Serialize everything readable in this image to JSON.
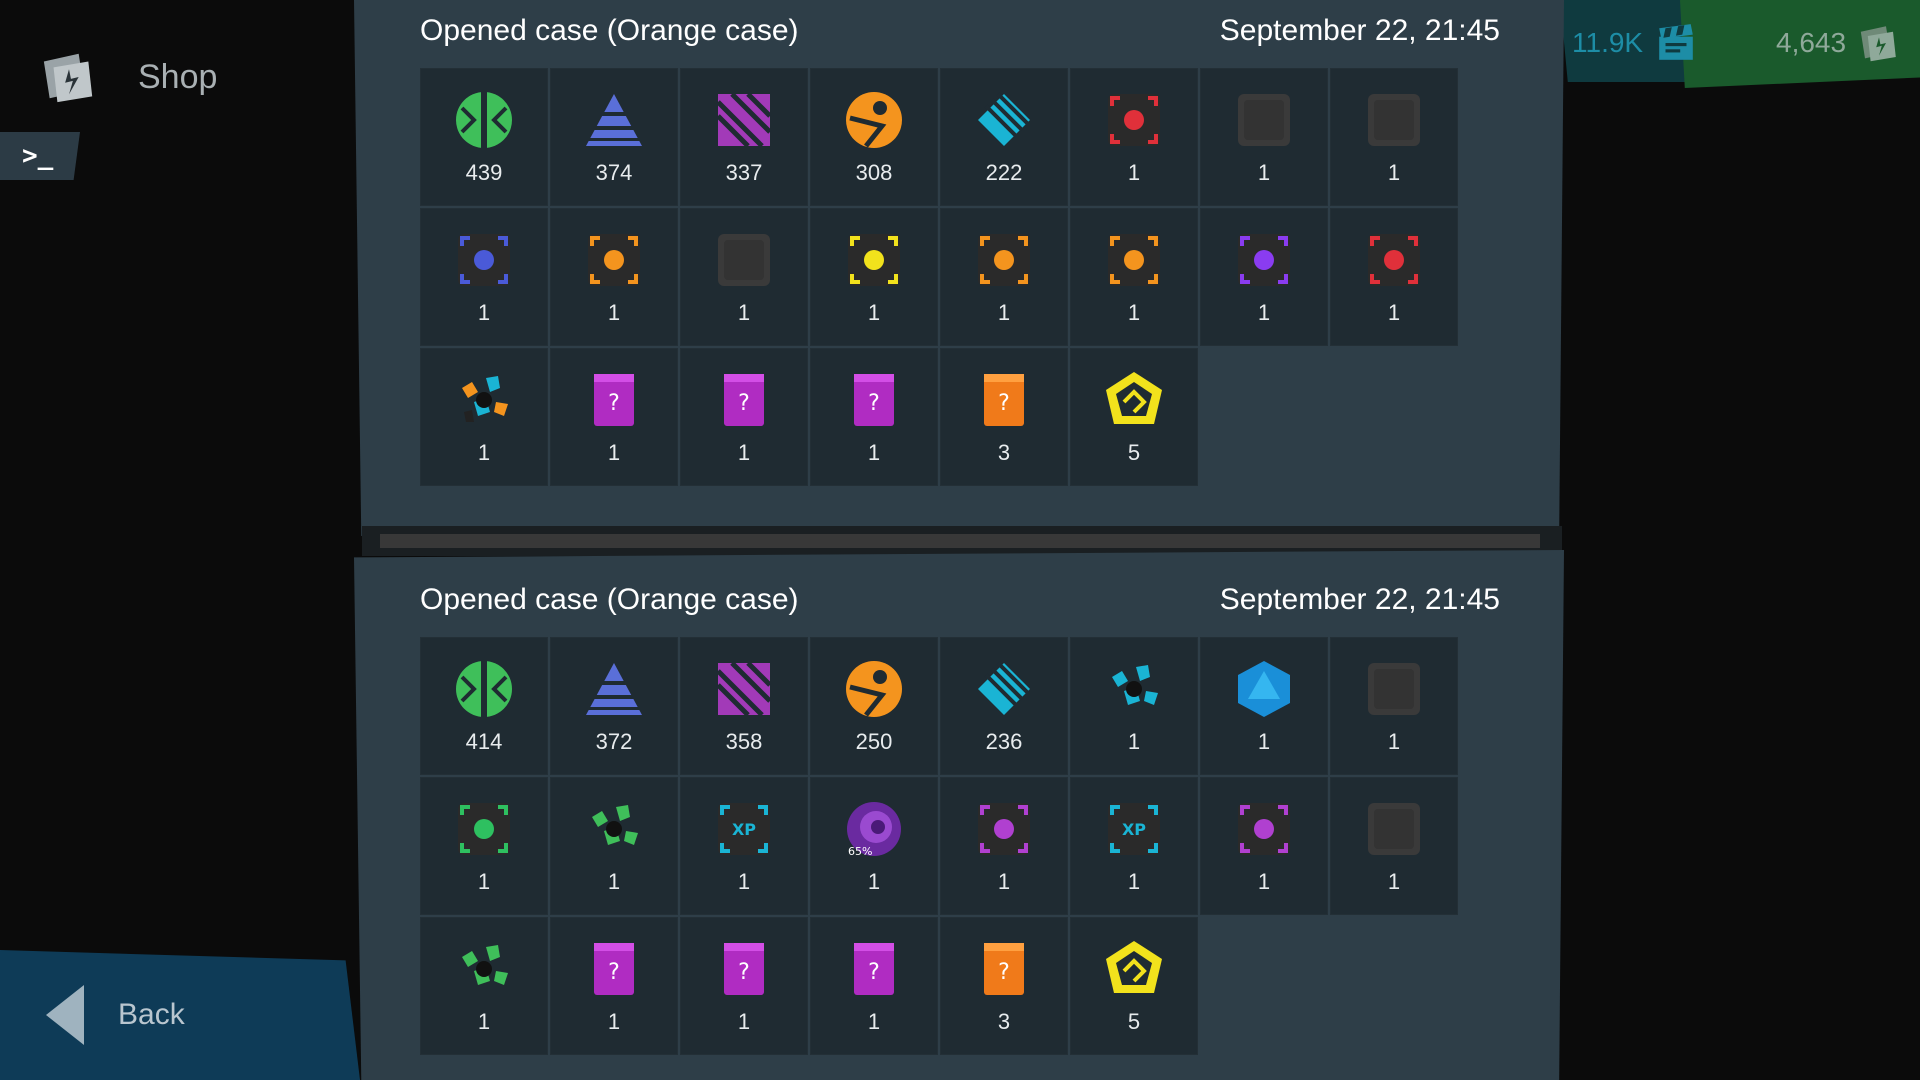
{
  "sidebar": {
    "shop_label": "Shop",
    "shop_icon": "shop-cards-icon",
    "console_label": ">_",
    "back_label": "Back"
  },
  "currencies": [
    {
      "value": "11.9K",
      "icon": "film-clapper-icon",
      "color": "#1d8da6"
    },
    {
      "value": "4,643",
      "icon": "shop-cards-icon",
      "color": "#8fa99a"
    }
  ],
  "cases": [
    {
      "title": "Opened case (Orange case)",
      "date": "September 22, 21:45",
      "items": [
        {
          "icon": "green-split-icon",
          "count": "439"
        },
        {
          "icon": "blue-pyramid-icon",
          "count": "374"
        },
        {
          "icon": "purple-stripes-icon",
          "count": "337"
        },
        {
          "icon": "orange-figure-icon",
          "count": "308"
        },
        {
          "icon": "cyan-chevron-icon",
          "count": "222"
        },
        {
          "icon": "red-fist-module-icon",
          "count": "1"
        },
        {
          "icon": "empty-slot-icon",
          "count": "1"
        },
        {
          "icon": "empty-slot-icon",
          "count": "1"
        },
        {
          "icon": "blue-module-icon",
          "count": "1"
        },
        {
          "icon": "orange-gear-module-icon",
          "count": "1"
        },
        {
          "icon": "empty-slot-icon",
          "count": "1"
        },
        {
          "icon": "yellow-chip-module-icon",
          "count": "1"
        },
        {
          "icon": "orange-gear-module-icon",
          "count": "1"
        },
        {
          "icon": "orange-gear-module-icon",
          "count": "1"
        },
        {
          "icon": "purple-key-module-icon",
          "count": "1"
        },
        {
          "icon": "red-fist-module-icon",
          "count": "1"
        },
        {
          "icon": "mixed-crystals-icon",
          "count": "1"
        },
        {
          "icon": "purple-mystery-card-icon",
          "count": "1"
        },
        {
          "icon": "purple-mystery-card-icon",
          "count": "1"
        },
        {
          "icon": "purple-mystery-card-icon",
          "count": "1"
        },
        {
          "icon": "orange-mystery-card-icon",
          "count": "3"
        },
        {
          "icon": "yellow-badge-icon",
          "count": "5"
        }
      ]
    },
    {
      "title": "Opened case (Orange case)",
      "date": "September 22, 21:45",
      "items": [
        {
          "icon": "green-split-icon",
          "count": "414"
        },
        {
          "icon": "blue-pyramid-icon",
          "count": "372"
        },
        {
          "icon": "purple-stripes-icon",
          "count": "358"
        },
        {
          "icon": "orange-figure-icon",
          "count": "250"
        },
        {
          "icon": "cyan-chevron-icon",
          "count": "236"
        },
        {
          "icon": "cyan-crystals-icon",
          "count": "1"
        },
        {
          "icon": "blue-gem-icon",
          "count": "1"
        },
        {
          "icon": "empty-slot-icon",
          "count": "1"
        },
        {
          "icon": "green-swirl-module-icon",
          "count": "1"
        },
        {
          "icon": "green-crystals-icon",
          "count": "1"
        },
        {
          "icon": "xp-boost-module-icon",
          "count": "1"
        },
        {
          "icon": "purple-portal-icon",
          "count": "1",
          "badge": "65%"
        },
        {
          "icon": "purple-hand-module-icon",
          "count": "1"
        },
        {
          "icon": "xp-boost-module-icon",
          "count": "1"
        },
        {
          "icon": "purple-hand-module-icon",
          "count": "1"
        },
        {
          "icon": "empty-slot-icon",
          "count": "1"
        },
        {
          "icon": "green-crystals-icon",
          "count": "1"
        },
        {
          "icon": "purple-mystery-card-icon",
          "count": "1"
        },
        {
          "icon": "purple-mystery-card-icon",
          "count": "1"
        },
        {
          "icon": "purple-mystery-card-icon",
          "count": "1"
        },
        {
          "icon": "orange-mystery-card-icon",
          "count": "3"
        },
        {
          "icon": "yellow-badge-icon",
          "count": "5"
        }
      ]
    }
  ]
}
